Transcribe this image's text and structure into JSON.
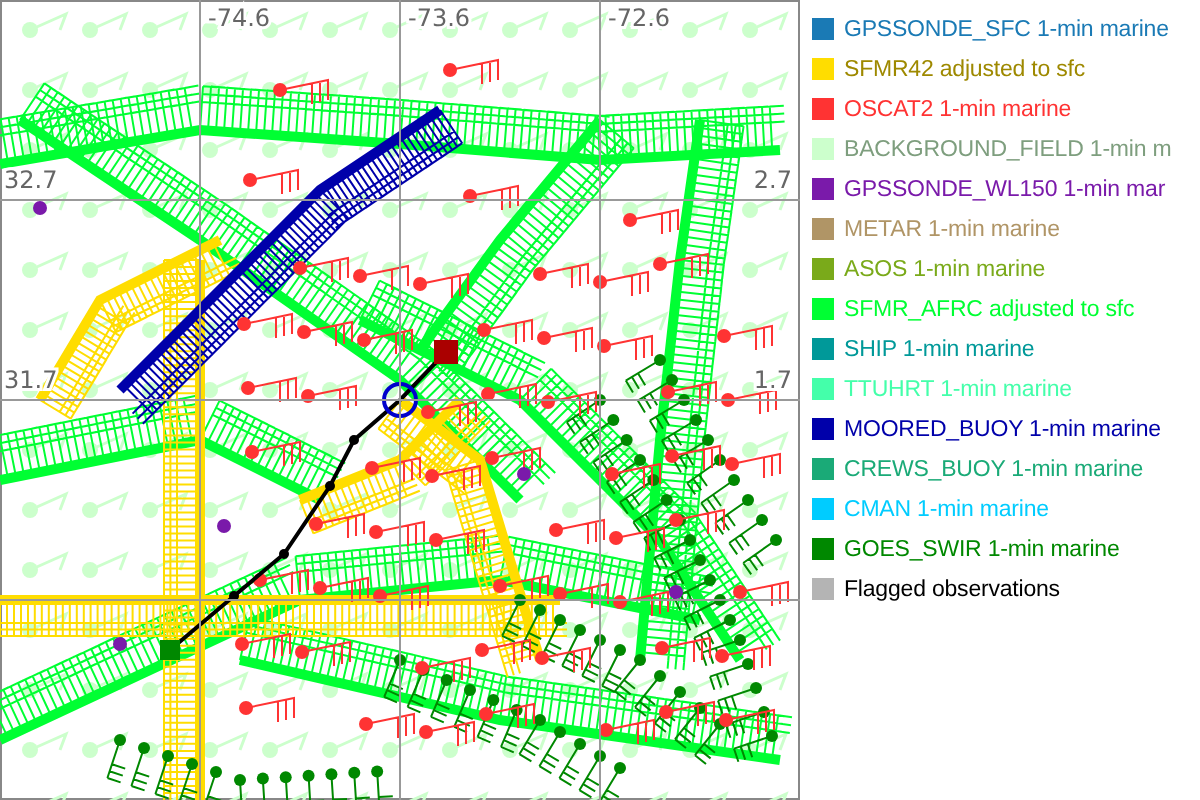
{
  "map": {
    "longitude_labels": [
      {
        "text": "-74.6"
      },
      {
        "text": "-73.6"
      },
      {
        "text": "-72.6"
      }
    ],
    "latitude_labels_left": [
      {
        "text": "32.7"
      },
      {
        "text": "31.7"
      }
    ],
    "latitude_labels_right": [
      {
        "text": "2.7"
      },
      {
        "text": "1.7"
      }
    ]
  },
  "legend": [
    {
      "kind": "series",
      "label": "GPSSONDE_SFC 1-min marine",
      "color": "#1a7ab5"
    },
    {
      "kind": "series",
      "label": "SFMR42 adjusted to sfc",
      "color": "#ffdd00"
    },
    {
      "kind": "series",
      "label": "OSCAT2 1-min marine",
      "color": "#ff3333"
    },
    {
      "kind": "series",
      "label": "BACKGROUND_FIELD 1-min m",
      "color": "#ccffcc"
    },
    {
      "kind": "series",
      "label": "GPSSONDE_WL150 1-min mar",
      "color": "#7a1aaa"
    },
    {
      "kind": "series",
      "label": "METAR 1-min marine",
      "color": "#b09566"
    },
    {
      "kind": "series",
      "label": "ASOS 1-min marine",
      "color": "#7aaa1a"
    },
    {
      "kind": "series",
      "label": "SFMR_AFRC adjusted to sfc",
      "color": "#00ff33"
    },
    {
      "kind": "series",
      "label": "SHIP 1-min marine",
      "color": "#009999"
    },
    {
      "kind": "series",
      "label": "TTUHRT 1-min marine",
      "color": "#44ffaa"
    },
    {
      "kind": "series",
      "label": "MOORED_BUOY 1-min marine",
      "color": "#0000aa"
    },
    {
      "kind": "series",
      "label": "CREWS_BUOY 1-min marine",
      "color": "#1aaa77"
    },
    {
      "kind": "series",
      "label": "CMAN 1-min marine",
      "color": "#00ccff"
    },
    {
      "kind": "series",
      "label": "GOES_SWIR 1-min marine",
      "color": "#008800"
    },
    {
      "kind": "flagged",
      "label": "Flagged observations",
      "color": "#b4b4b4"
    }
  ]
}
